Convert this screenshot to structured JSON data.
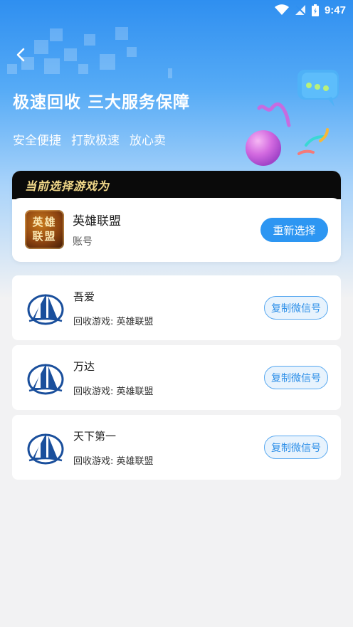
{
  "status_bar": {
    "time": "9:47"
  },
  "hero": {
    "title": "极速回收 三大服务保障",
    "features": [
      "安全便捷",
      "打款极速",
      "放心卖"
    ]
  },
  "current_selection": {
    "header": "当前选择游戏为",
    "game_icon_text": [
      "英雄",
      "联盟"
    ],
    "game_name": "英雄联盟",
    "game_type": "账号",
    "reselect_label": "重新选择"
  },
  "merchants": [
    {
      "name": "吾爱",
      "game": "回收游戏: 英雄联盟",
      "copy_label": "复制微信号"
    },
    {
      "name": "万达",
      "game": "回收游戏: 英雄联盟",
      "copy_label": "复制微信号"
    },
    {
      "name": "天下第一",
      "game": "回收游戏: 英雄联盟",
      "copy_label": "复制微信号"
    }
  ],
  "colors": {
    "accent": "#2d96f2",
    "header_bg": "#0a0a0a",
    "header_text": "#f2d98a",
    "page_bg": "#f2f2f3"
  }
}
